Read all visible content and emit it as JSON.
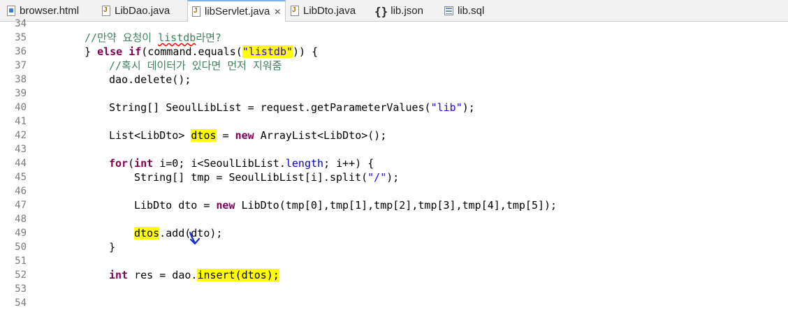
{
  "tabs": [
    {
      "label": "browser.html",
      "icon": "html-file-icon"
    },
    {
      "label": "LibDao.java",
      "icon": "java-file-icon"
    },
    {
      "label": "libServlet.java",
      "icon": "java-file-icon",
      "close": "✕"
    },
    {
      "label": "LibDto.java",
      "icon": "java-file-icon"
    },
    {
      "label": "lib.json",
      "icon": "json-file-icon",
      "glyph": "{}"
    },
    {
      "label": "lib.sql",
      "icon": "sql-file-icon"
    }
  ],
  "line_numbers": [
    "34",
    "35",
    "36",
    "37",
    "38",
    "39",
    "40",
    "41",
    "42",
    "43",
    "44",
    "45",
    "46",
    "47",
    "48",
    "49",
    "50",
    "51",
    "52",
    "53",
    "54"
  ],
  "code": {
    "l35_comment": "//만약 요청이 ",
    "l35_word": "listdb",
    "l35_tail": "라면?",
    "l36_brace": "} ",
    "l36_else": "else",
    "l36_if": "if",
    "l36_mid": "(command.equals(",
    "l36_str": "\"listdb\"",
    "l36_end": ")) {",
    "l37_comment": "//혹시 데이터가 있다면 먼저 지워줌",
    "l38": "dao.delete();",
    "l40_a": "String[] SeoulLibList = request.getParameterValues(",
    "l40_str": "\"lib\"",
    "l40_b": ");",
    "l42_a": "List<LibDto> ",
    "l42_hl": "dtos",
    "l42_b": " = ",
    "l42_new": "new",
    "l42_c": " ArrayList<LibDto>();",
    "l44_for": "for",
    "l44_a": "(",
    "l44_int": "int",
    "l44_b": " i=0; i<SeoulLibList.",
    "l44_field": "length",
    "l44_c": "; i++) {",
    "l45_a": "String[] tmp = SeoulLibList[i].split(",
    "l45_str": "\"/\"",
    "l45_b": ");",
    "l47_a": "LibDto dto = ",
    "l47_new": "new",
    "l47_b": " LibDto(tmp[0],tmp[1],tmp[2],tmp[3],tmp[4],tmp[5]);",
    "l49_hl": "dtos",
    "l49_b": ".add(dto);",
    "l50": "}",
    "l52_int": "int",
    "l52_a": " res = dao.",
    "l52_hl": "insert(dtos);"
  },
  "colors": {
    "highlight": "#ffff00",
    "keyword": "#7f0055",
    "string": "#2a00ff",
    "comment": "#3f7f5f",
    "annotation_arrow": "#1a2bd6"
  }
}
